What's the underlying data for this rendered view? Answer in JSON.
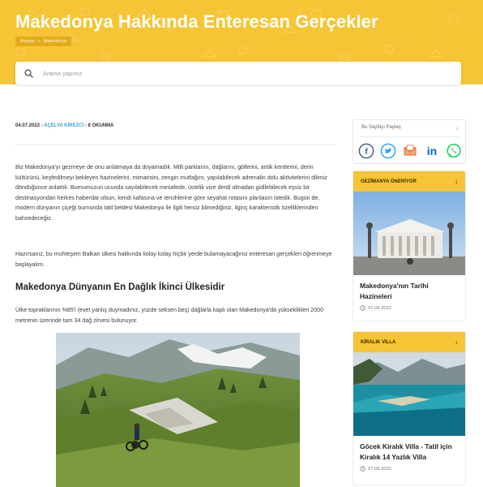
{
  "header": {
    "title": "Makedonya Hakkında Enteresan Gerçekler",
    "breadcrumb": {
      "items": [
        "Avrupa",
        "Makedonya"
      ],
      "separator": ">"
    },
    "search_placeholder": "Arama yapınız"
  },
  "article": {
    "date": "04.07.2022",
    "separator": " - ",
    "author": "AÇELYA KİREZCİ",
    "reads": "8 OKUNMA",
    "paragraph1": "Biz Makedonya'yı gezmeye de onu anlatmaya da doyamadık. Milli parklarını, dağlarını, göllerini, antik kentlerini, derin kültürünü, keşfedilmeyi bekleyen hazinelerini, mimarisini, zengin mutfağını, yapılabilecek adrenalin dolu aktivitelerini dilimiz döndüğünce anlattık. Burnumuzun ucunda sayılabilecek mesafede, üstelik vize derdi olmadan gidilebilecek eşsiz bir destinasyondan herkes haberdar olsun, kendi kafasına ve tercihlerine göre seyahat rotasını planlasın istedik. Bugün de, modern dünyanın çiçeği burnunda tatil beldesi Makedonya ile ilgili henüz bilmediğiniz, ilginç karakteristik özelliklerinden bahsedeceğiz.",
    "paragraph2": "Hazırsanız, bu muhteşem Balkan ülkesi hakkında kolay kolay hiçbir yerde bulamayacağınız enteresan gerçekleri öğrenmeye başlayalım.",
    "heading1": "Makedonya Dünyanın En Dağlık İkinci Ülkesidir",
    "paragraph3": "Ülke topraklarının %85'i (evet yanlış duymadınız, yüzde seksen beş) dağlarla kaplı olan Makedonya'da yükseklikleri 2000 metrenin üzerinde tam 34 dağ zirvesi bulunuyor."
  },
  "sidebar": {
    "share": {
      "title": "Bu Sayfayı Paylaş",
      "arrow": "↓",
      "icons": [
        "facebook-icon",
        "twitter-icon",
        "email-icon",
        "linkedin-icon",
        "whatsapp-icon"
      ]
    },
    "card1": {
      "header": "GEZİMANYA ÖNERİYOR",
      "arrow": "↓",
      "title": "Makedonya'nın Tarihi Hazineleri",
      "date": "01.08.2022"
    },
    "card2": {
      "header": "KİRALIK VİLLA",
      "arrow": "↓",
      "title": "Göcek Kiralık Villa - Tatil için Kiralık 14 Yazlık Villa",
      "date": "27.08.2022"
    }
  },
  "colors": {
    "brand_yellow": "#f6c536",
    "author_blue": "#3aa0c9"
  }
}
